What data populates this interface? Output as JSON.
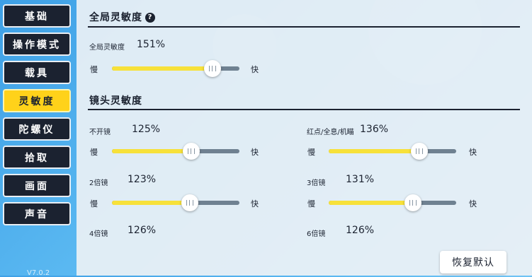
{
  "sidebar": {
    "items": [
      {
        "label": "基础",
        "active": false
      },
      {
        "label": "操作模式",
        "active": false
      },
      {
        "label": "载具",
        "active": false
      },
      {
        "label": "灵敏度",
        "active": true
      },
      {
        "label": "陀螺仪",
        "active": false
      },
      {
        "label": "拾取",
        "active": false
      },
      {
        "label": "画面",
        "active": false
      },
      {
        "label": "声音",
        "active": false
      }
    ],
    "footer": "V7.0.2"
  },
  "global_section": {
    "title": "全局灵敏度",
    "help_icon": "question-mark-icon",
    "slider": {
      "label": "全局灵敏度",
      "value_text": "151%",
      "level": 0.79,
      "slow": "慢",
      "fast": "快"
    }
  },
  "camera_section": {
    "title": "镜头灵敏度",
    "sliders": [
      {
        "label": "不开镜",
        "value_text": "125%",
        "level": 0.62,
        "slow": "慢",
        "fast": "快"
      },
      {
        "label": "红点/全息/机瞄",
        "value_text": "136%",
        "level": 0.71,
        "slow": "慢",
        "fast": "快"
      },
      {
        "label": "2倍镜",
        "value_text": "123%",
        "level": 0.61,
        "slow": "慢",
        "fast": "快"
      },
      {
        "label": "3倍镜",
        "value_text": "131%",
        "level": 0.66,
        "slow": "慢",
        "fast": "快"
      },
      {
        "label": "4倍镜",
        "value_text": "126%"
      },
      {
        "label": "6倍镜",
        "value_text": "126%"
      }
    ]
  },
  "reset_button": {
    "label": "恢复默认"
  },
  "colors": {
    "accent_yellow": "#ffd21a",
    "fill_yellow": "#f7e13a",
    "dark": "#1b2230",
    "track": "#6f8191"
  }
}
